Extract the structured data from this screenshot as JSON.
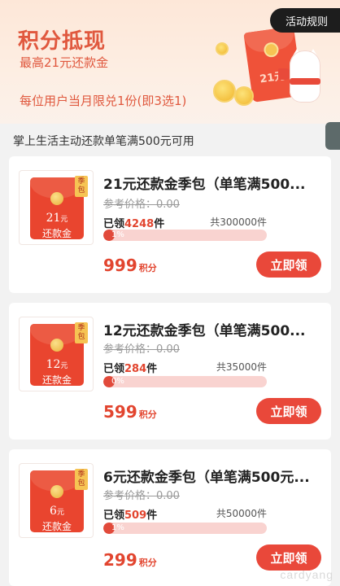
{
  "banner": {
    "title": "积分抵现",
    "subtitle": "最高21元还款金",
    "limit_text": "每位用户当月限兑1份(即3选1)",
    "rules_label": "活动规则",
    "envelope_amount": "21元"
  },
  "section_note": "掌上生活主动还款单笔满500元可用",
  "items": [
    {
      "thumb_amount": "21",
      "thumb_unit": "元",
      "thumb_label": "还款金",
      "season_tag": "季包",
      "title": "21元还款金季包（单笔满500...",
      "ref_price": "参考价格：0.00",
      "claimed_prefix": "已领",
      "claimed_count": "4248",
      "claimed_suffix": "件",
      "total": "共300000件",
      "progress_label": "1%",
      "progress_fraction": 0.014,
      "price": "999",
      "price_unit": "积分",
      "button": "立即领"
    },
    {
      "thumb_amount": "12",
      "thumb_unit": "元",
      "thumb_label": "还款金",
      "season_tag": "季包",
      "title": "12元还款金季包（单笔满500...",
      "ref_price": "参考价格：0.00",
      "claimed_prefix": "已领",
      "claimed_count": "284",
      "claimed_suffix": "件",
      "total": "共35000件",
      "progress_label": "0%",
      "progress_fraction": 0.008,
      "price": "599",
      "price_unit": "积分",
      "button": "立即领"
    },
    {
      "thumb_amount": "6",
      "thumb_unit": "元",
      "thumb_label": "还款金",
      "season_tag": "季包",
      "title": "6元还款金季包（单笔满500元...",
      "ref_price": "参考价格：0.00",
      "claimed_prefix": "已领",
      "claimed_count": "509",
      "claimed_suffix": "件",
      "total": "共50000件",
      "progress_label": "1%",
      "progress_fraction": 0.01,
      "price": "299",
      "price_unit": "积分",
      "button": "立即领"
    }
  ],
  "watermark": "cardyang",
  "colors": {
    "accent": "#e9483a",
    "banner_text": "#e0583e",
    "progress_track": "#f9d3d0"
  }
}
